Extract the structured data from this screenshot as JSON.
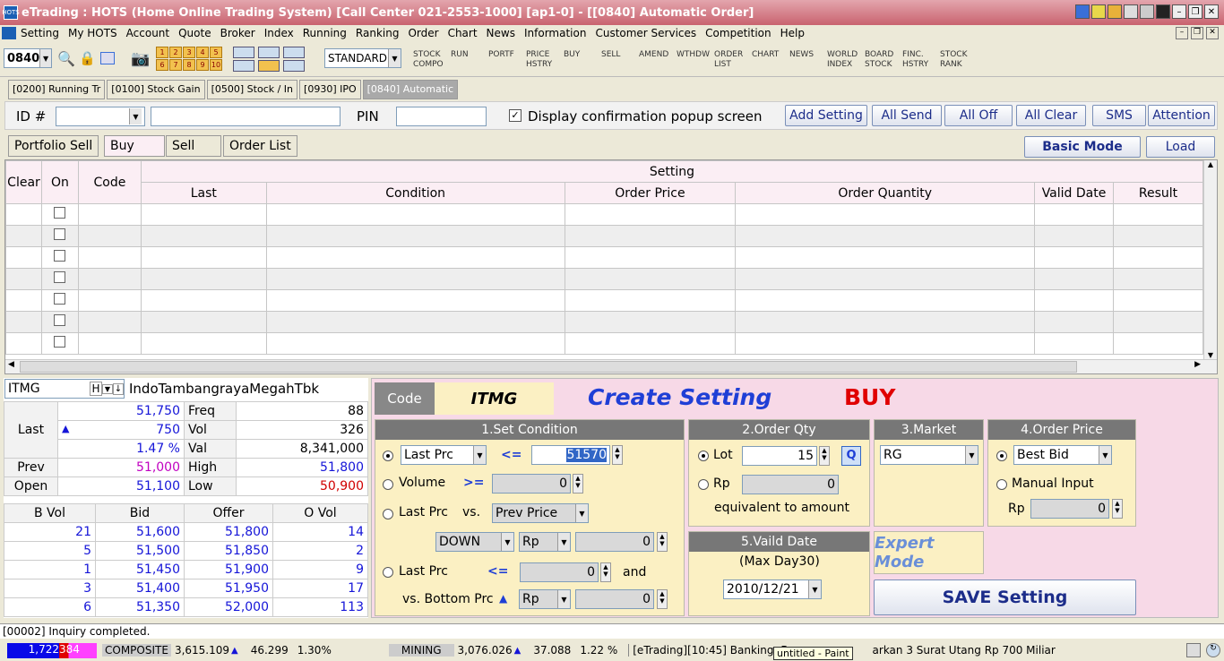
{
  "window": {
    "title": "eTrading : HOTS (Home Online Trading System) [Call Center 021-2553-1000] [ap1-0] - [[0840] Automatic Order]",
    "app_icon": "HOTS"
  },
  "menu": [
    "Setting",
    "My HOTS",
    "Account",
    "Quote",
    "Broker",
    "Index",
    "Running",
    "Ranking",
    "Order",
    "Chart",
    "News",
    "Information",
    "Customer Services",
    "Competition",
    "Help"
  ],
  "toolbar": {
    "screen_code": "0840",
    "layout": "STANDARD",
    "numbers": [
      "1",
      "2",
      "3",
      "4",
      "5",
      "6",
      "7",
      "8",
      "9",
      "10"
    ],
    "buttons": [
      [
        "STOCK",
        "COMPO"
      ],
      [
        "RUN",
        ""
      ],
      [
        "PORTF",
        ""
      ],
      [
        "PRICE",
        "HSTRY"
      ],
      [
        "BUY",
        ""
      ],
      [
        "SELL",
        ""
      ],
      [
        "AMEND",
        ""
      ],
      [
        "WTHDW",
        ""
      ],
      [
        "ORDER",
        "LIST"
      ],
      [
        "CHART",
        ""
      ],
      [
        "NEWS",
        ""
      ],
      [
        "WORLD",
        "INDEX"
      ],
      [
        "BOARD",
        "STOCK"
      ],
      [
        "FINC.",
        "HSTRY"
      ],
      [
        "STOCK",
        "RANK"
      ]
    ]
  },
  "tabs": [
    "[0200] Running Tr",
    "[0100] Stock Gain",
    "[0500] Stock / In",
    "[0930] IPO",
    "[0840] Automatic"
  ],
  "form": {
    "id_label": "ID #",
    "pin_label": "PIN",
    "confirm_label": "Display confirmation popup screen",
    "confirm_checked": true,
    "buttons": [
      "Add Setting",
      "All Send",
      "All Off",
      "All Clear",
      "SMS",
      "Attention"
    ]
  },
  "subtabs": [
    "Portfolio Sell",
    "Buy",
    "Sell",
    "Order List"
  ],
  "mode_buttons": {
    "basic": "Basic Mode",
    "load": "Load"
  },
  "grid": {
    "group_header": "Setting",
    "headers": [
      "Clear",
      "On",
      "Code",
      "Last",
      "Condition",
      "Order Price",
      "Order Quantity",
      "Valid Date",
      "Result"
    ],
    "row_count": 7
  },
  "quote": {
    "code": "ITMG",
    "h_label": "H",
    "name": "IndoTambangrayaMegahTbk",
    "last_label": "Last",
    "last": "51,750",
    "change": "750",
    "change_pct": "1.47 %",
    "freq_label": "Freq",
    "freq": "88",
    "vol_label": "Vol",
    "vol": "326",
    "val_label": "Val",
    "val": "8,341,000",
    "prev_label": "Prev",
    "prev": "51,000",
    "high_label": "High",
    "high": "51,800",
    "open_label": "Open",
    "open": "51,100",
    "low_label": "Low",
    "low": "50,900",
    "book_headers": [
      "B Vol",
      "Bid",
      "Offer",
      "O Vol"
    ],
    "book": [
      [
        "21",
        "51,600",
        "51,800",
        "14"
      ],
      [
        "5",
        "51,500",
        "51,850",
        "2"
      ],
      [
        "1",
        "51,450",
        "51,900",
        "9"
      ],
      [
        "3",
        "51,400",
        "51,950",
        "17"
      ],
      [
        "6",
        "51,350",
        "52,000",
        "113"
      ]
    ]
  },
  "create": {
    "code_label": "Code",
    "code": "ITMG",
    "title": "Create Setting",
    "side": "BUY",
    "set_condition": {
      "header": "1.Set Condition",
      "r1_type": "Last Prc",
      "r1_op": "<=",
      "r1_value": "51570",
      "r2_label": "Volume",
      "r2_op": ">=",
      "r2_value": "0",
      "r3_label": "Last Prc",
      "r3_vs": "vs.",
      "r3_ref": "Prev Price",
      "r3_dir": "DOWN",
      "r3_unit": "Rp",
      "r3_value": "0",
      "r4_label": "Last Prc",
      "r4_op": "<=",
      "r4_value": "0",
      "r4_and": "and",
      "r4_vs": "vs. Bottom Prc",
      "r4_unit": "Rp",
      "r4_value2": "0"
    },
    "order_qty": {
      "header": "2.Order Qty",
      "lot_label": "Lot",
      "lot": "15",
      "q_btn": "Q",
      "rp_label": "Rp",
      "rp": "0",
      "equiv": "equivalent to amount"
    },
    "market": {
      "header": "3.Market",
      "value": "RG"
    },
    "order_price": {
      "header": "4.Order Price",
      "option": "Best Bid",
      "manual_label": "Manual Input",
      "rp_label": "Rp",
      "rp": "0"
    },
    "valid_date": {
      "header": "5.Vaild Date",
      "max": "(Max Day30)",
      "date": "2010/12/21"
    },
    "expert": "Expert Mode",
    "save": "SAVE Setting"
  },
  "status": "[00002] Inquiry completed.",
  "ticker": {
    "vol_a": "1,722",
    "vol_b": "384",
    "idx1_name": "COMPOSITE",
    "idx1_val": "3,615.109",
    "idx1_chg": "46.299",
    "idx1_pct": "1.30%",
    "idx2_name": "MINING",
    "idx2_val": "3,076.026",
    "idx2_chg": "37.088",
    "idx2_pct": "1.22 %",
    "news": "[eTrading][10:45] Banking: Ban",
    "news2": "arkan 3 Surat Utang Rp 700 Miliar",
    "tooltip": "untitled - Paint"
  },
  "colors": {
    "buy": "#e00000",
    "title_blue": "#1f3fd6",
    "up": "#1515d8"
  }
}
